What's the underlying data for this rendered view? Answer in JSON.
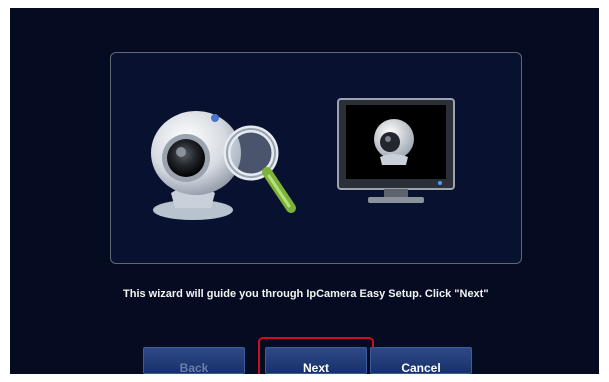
{
  "wizard": {
    "message": "This wizard will guide you through IpCamera Easy Setup. Click \"Next\""
  },
  "buttons": {
    "back_label": "Back",
    "next_label": "Next",
    "cancel_label": "Cancel"
  },
  "icons": {
    "camera_search": "webcam-magnifier-icon",
    "monitor_camera": "monitor-webcam-icon"
  },
  "colors": {
    "background": "#050c22",
    "button": "#1f3a78",
    "highlight": "#c8101e",
    "magnifier_handle": "#8bc34a"
  }
}
